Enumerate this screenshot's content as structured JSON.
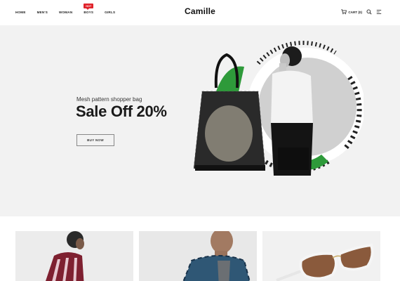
{
  "header": {
    "nav": [
      {
        "label": "HOME"
      },
      {
        "label": "MEN'S"
      },
      {
        "label": "WOMAN"
      },
      {
        "label": "BOYS",
        "badge": "HOT"
      },
      {
        "label": "GIRLS"
      }
    ],
    "logo": "Camille",
    "cart_label": "CART (0)",
    "icons": [
      "cart-icon",
      "search-icon",
      "menu-icon"
    ]
  },
  "hero": {
    "subtitle": "Mesh pattern shopper bag",
    "title": "Sale Off 20%",
    "button_label": "BUY NOW"
  },
  "colors": {
    "badge": "#e0232b",
    "hero_bg": "#f2f2f2",
    "accent_green": "#2e9a3a"
  }
}
